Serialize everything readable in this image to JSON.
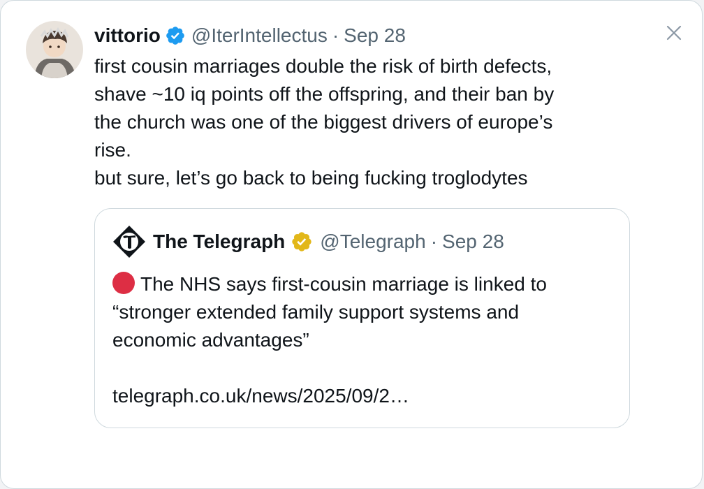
{
  "tweet": {
    "display_name": "vittorio",
    "handle": "@IterIntellectus",
    "separator": "·",
    "date": "Sep 28",
    "text_lines": [
      "first cousin marriages double the risk of birth defects,",
      "shave ~10 iq points off the offspring, and their ban by",
      "the church was one of the biggest drivers of europe’s",
      "rise.",
      "but sure, let’s go back to being fucking troglodytes"
    ],
    "verified_badge_color": "#1d9bf0"
  },
  "quoted_tweet": {
    "display_name": "The Telegraph",
    "handle": "@Telegraph",
    "separator": "·",
    "date": "Sep 28",
    "text_lines": [
      "The NHS says first-cousin marriage is linked to",
      "“stronger extended family support systems and",
      "economic advantages”"
    ],
    "link": "telegraph.co.uk/news/2025/09/2…",
    "verified_badge_color": "#e2b719",
    "leading_emoji": "red-circle"
  },
  "icons": {
    "close": "close-icon",
    "verified": "verified-badge-icon",
    "gold_verified": "gold-verified-badge-icon"
  },
  "colors": {
    "text_primary": "#0f1419",
    "text_secondary": "#536471",
    "border": "#cfd9de",
    "red_circle": "#dd2e44"
  }
}
